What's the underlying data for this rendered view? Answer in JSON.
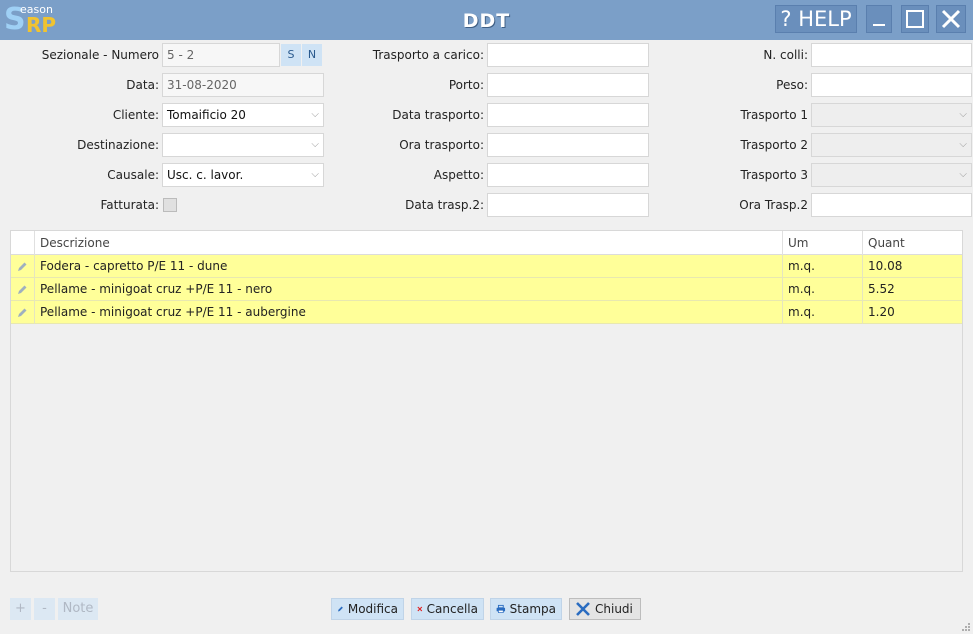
{
  "app": {
    "logo_top": "eason",
    "logo_s": "S",
    "logo_rp": "RP",
    "title": "DDT"
  },
  "titlebar": {
    "help_label": "? HELP",
    "minimize_label": "_"
  },
  "form": {
    "sezionale_label": "Sezionale - Numero",
    "sezionale_value": "5 - 2",
    "s_label": "S",
    "n_label": "N",
    "data_label": "Data:",
    "data_value": "31-08-2020",
    "cliente_label": "Cliente:",
    "cliente_value": "Tomaificio 20",
    "destinazione_label": "Destinazione:",
    "destinazione_value": "",
    "causale_label": "Causale:",
    "causale_value": "Usc. c. lavor.",
    "fatturata_label": "Fatturata:",
    "trasporto_carico_label": "Trasporto a carico:",
    "trasporto_carico_value": "",
    "porto_label": "Porto:",
    "porto_value": "",
    "data_trasporto_label": "Data trasporto:",
    "data_trasporto_value": "",
    "ora_trasporto_label": "Ora trasporto:",
    "ora_trasporto_value": "",
    "aspetto_label": "Aspetto:",
    "aspetto_value": "",
    "data_trasp2_label": "Data trasp.2:",
    "data_trasp2_value": "",
    "ncolli_label": "N. colli:",
    "ncolli_value": "",
    "peso_label": "Peso:",
    "peso_value": "",
    "trasporto1_label": "Trasporto 1",
    "trasporto1_value": "",
    "trasporto2_label": "Trasporto 2",
    "trasporto2_value": "",
    "trasporto3_label": "Trasporto 3",
    "trasporto3_value": "",
    "ora_trasp2_label": "Ora Trasp.2",
    "ora_trasp2_value": ""
  },
  "table": {
    "headers": [
      "Descrizione",
      "Um",
      "Quant"
    ],
    "rows": [
      {
        "descrizione": "Fodera - capretto P/E 11 - dune",
        "um": "m.q.",
        "quant": "10.08"
      },
      {
        "descrizione": "Pellame - minigoat cruz +P/E 11 - nero",
        "um": "m.q.",
        "quant": "5.52"
      },
      {
        "descrizione": "Pellame - minigoat cruz +P/E 11 - aubergine",
        "um": "m.q.",
        "quant": "1.20"
      }
    ]
  },
  "footer": {
    "add_label": "+",
    "remove_label": "-",
    "note_label": "Note",
    "modifica_label": "Modifica",
    "cancella_label": "Cancella",
    "stampa_label": "Stampa",
    "chiudi_label": "Chiudi"
  },
  "colors": {
    "titlebar": "#7b9fc8",
    "row_highlight": "#ffff99",
    "button_accent": "#cfe3f5",
    "delete_red": "#e02020",
    "action_blue": "#2a6cc0"
  }
}
